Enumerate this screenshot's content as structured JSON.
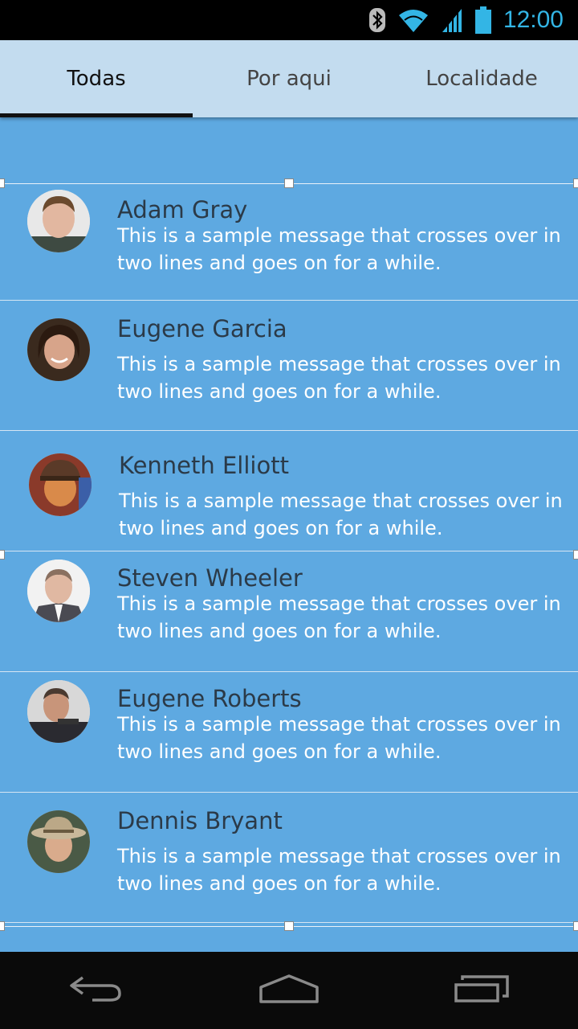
{
  "status_bar": {
    "time": "12:00",
    "icons": [
      "bluetooth-icon",
      "wifi-icon",
      "signal-icon",
      "battery-icon"
    ],
    "accent_color": "#33b5e5"
  },
  "tabs": [
    {
      "label": "Todas",
      "active": true
    },
    {
      "label": "Por aqui",
      "active": false
    },
    {
      "label": "Localidade",
      "active": false
    }
  ],
  "contacts": [
    {
      "name": "Adam Gray",
      "message": "This is a sample message that crosses over in two lines and goes on for a while."
    },
    {
      "name": "Eugene Garcia",
      "message": "This is a sample message that crosses over in two lines and goes on for a while."
    },
    {
      "name": "Kenneth Elliott",
      "message": "This is a sample message that crosses over in two lines and goes on for a while."
    },
    {
      "name": "Steven Wheeler",
      "message": "This is a sample message that crosses over in two lines and goes on for a while."
    },
    {
      "name": "Eugene Roberts",
      "message": "This is a sample message that crosses over in two lines and goes on for a while."
    },
    {
      "name": "Dennis Bryant",
      "message": "This is a sample message that crosses over in two lines and goes on for a while."
    }
  ],
  "nav_bar": {
    "icons": [
      "back-icon",
      "home-icon",
      "recents-icon"
    ]
  },
  "colors": {
    "tab_bar": "#c3dcef",
    "list_background": "#5ea9e1",
    "name_text": "#2b3a48",
    "message_text": "#ffffff"
  }
}
